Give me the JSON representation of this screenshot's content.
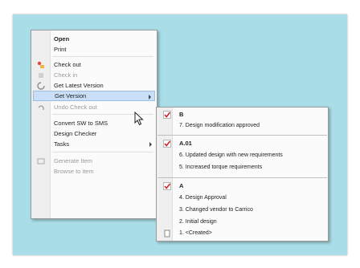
{
  "context_menu": {
    "items": [
      {
        "label": "Open",
        "style": "bold",
        "icon": "none"
      },
      {
        "label": "Print",
        "style": "normal",
        "icon": "none"
      },
      {
        "label": "Check out",
        "style": "normal",
        "icon": "check-out-icon"
      },
      {
        "label": "Check in",
        "style": "disabled",
        "icon": "check-in-icon"
      },
      {
        "label": "Get Latest Version",
        "style": "normal",
        "icon": "get-latest-icon"
      },
      {
        "label": "Get Version",
        "style": "highlight",
        "icon": "none",
        "submenu": true
      },
      {
        "label": "Undo Check out",
        "style": "disabled",
        "icon": "undo-icon"
      },
      {
        "label": "Convert SW to SMS",
        "style": "normal",
        "icon": "none"
      },
      {
        "label": "Design Checker",
        "style": "normal",
        "icon": "none"
      },
      {
        "label": "Tasks",
        "style": "normal",
        "icon": "none",
        "submenu": true
      },
      {
        "label": "Generate Item",
        "style": "disabled",
        "icon": "generate-item-icon"
      },
      {
        "label": "Browse to item",
        "style": "disabled",
        "icon": "none"
      }
    ]
  },
  "version_submenu": {
    "groups": [
      {
        "version": "B",
        "entries": [
          "7. Design modification approved"
        ]
      },
      {
        "version": "A.01",
        "entries": [
          "6. Updated design with new requirements",
          "5. Increased torque requirements"
        ]
      },
      {
        "version": "A",
        "entries": [
          "4. Design Approval",
          "3. Changed vendor to Carrico",
          "2. Initial design",
          "1. <Created>"
        ]
      }
    ]
  },
  "colors": {
    "frame_background": "#a9dde7",
    "highlight": "#c9dff7",
    "check_red": "#d0242c"
  }
}
